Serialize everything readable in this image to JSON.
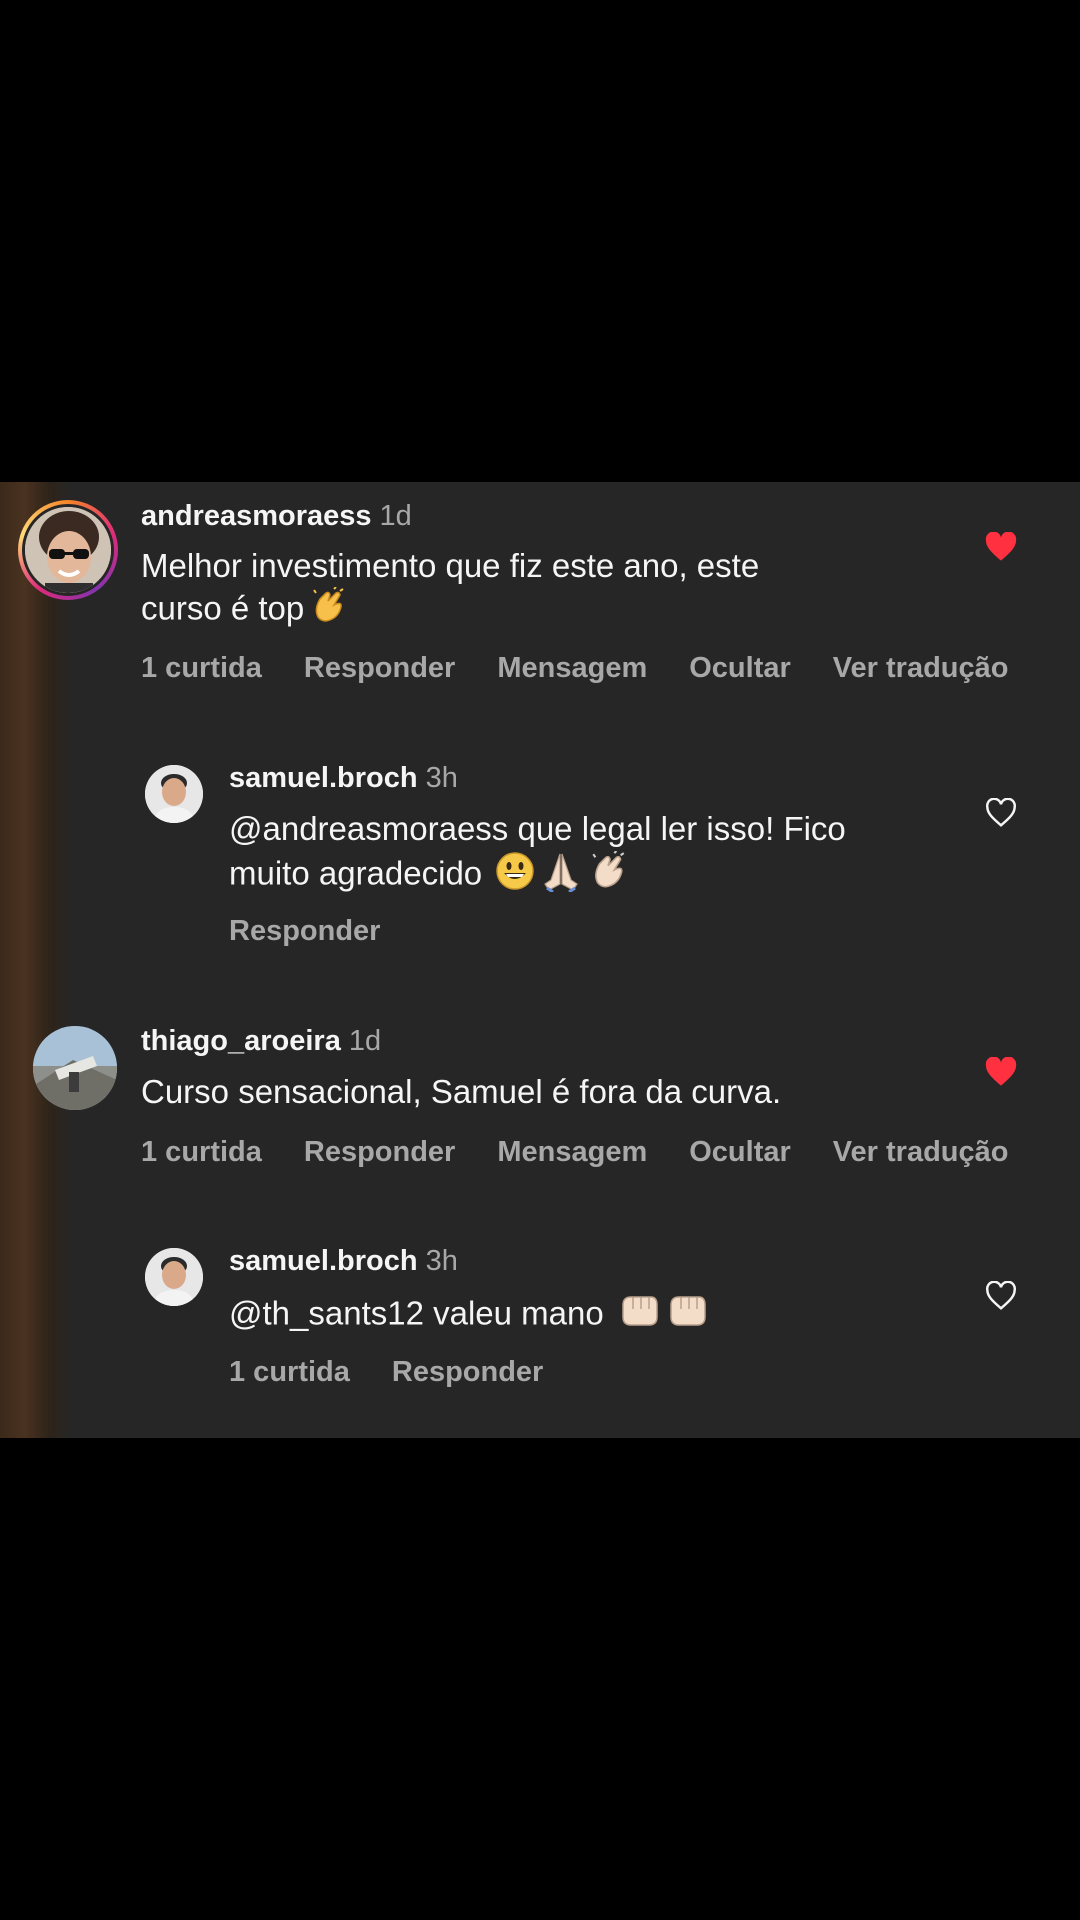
{
  "comments": [
    {
      "username": "andreasmoraess",
      "time": "1d",
      "text_line1": "Melhor investimento que fiz este ano, este",
      "text_line2": "curso é top",
      "emoji": "clapping-hands-icon",
      "likes": "1 curtida",
      "reply": "Responder",
      "message": "Mensagem",
      "hide": "Ocultar",
      "translate": "Ver tradução",
      "liked": true
    },
    {
      "username": "samuel.broch",
      "time": "3h",
      "text_line1": "@andreasmoraess que legal ler isso! Fico",
      "text_line2": "muito agradecido",
      "emoji": "grinning-face-icon, folded-hands-icon, clapping-hands-icon",
      "reply": "Responder",
      "liked": false
    },
    {
      "username": "thiago_aroeira",
      "time": "1d",
      "text_line1": "Curso sensacional, Samuel é fora da curva.",
      "likes": "1 curtida",
      "reply": "Responder",
      "message": "Mensagem",
      "hide": "Ocultar",
      "translate": "Ver tradução",
      "liked": true
    },
    {
      "username": "samuel.broch",
      "time": "3h",
      "text_line1": "@th_sants12 valeu mano",
      "emoji": "fist-bump-icon, fist-bump-icon",
      "likes": "1 curtida",
      "reply": "Responder",
      "liked": false
    }
  ],
  "colors": {
    "background": "#262626",
    "text": "#f5f5f5",
    "secondary": "#a8a8a8",
    "heart_liked": "#ff3040"
  }
}
